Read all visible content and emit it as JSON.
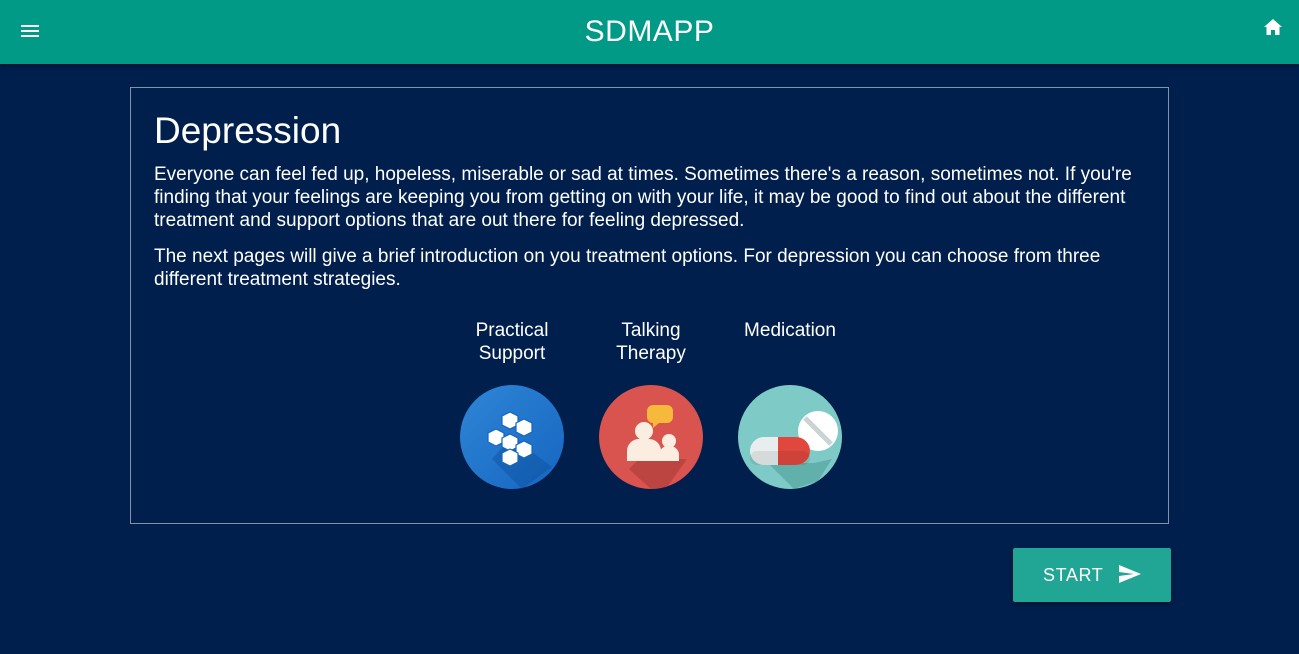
{
  "app": {
    "title": "SDMAPP",
    "menu_icon": "menu-icon",
    "home_icon": "home-icon",
    "colors": {
      "appbar": "#009a86",
      "background": "#001f4d",
      "button": "#21a594"
    }
  },
  "card": {
    "title": "Depression",
    "paragraph1": "Everyone can feel fed up, hopeless, miserable or sad at times. Sometimes there's a reason, sometimes not. If you're finding that your feelings are keeping you from getting on with your life, it may be good to find out about the different treatment and support options that are out there for feeling depressed.",
    "paragraph2": "The next pages will give a brief introduction on you treatment options. For depression you can choose from three different treatment strategies.",
    "options": [
      {
        "label": "Practical Support",
        "icon": "cubes-icon"
      },
      {
        "label": "Talking Therapy",
        "icon": "people-talking-icon"
      },
      {
        "label": "Medication",
        "icon": "pills-icon"
      }
    ]
  },
  "actions": {
    "start_label": "START",
    "start_icon": "send-icon"
  }
}
